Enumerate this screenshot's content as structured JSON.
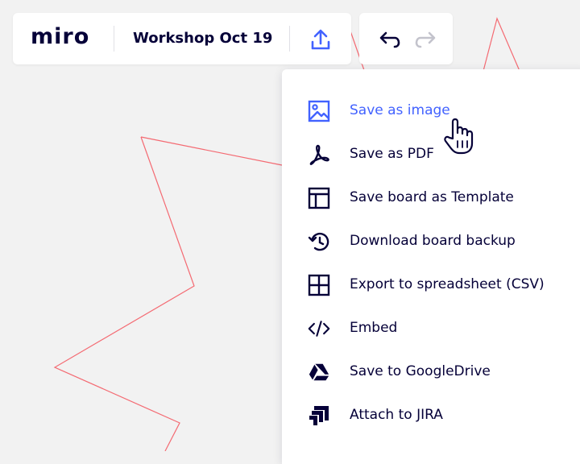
{
  "app": {
    "logo": "miro",
    "board_title": "Workshop Oct 19"
  },
  "toolbar": {
    "export_icon": "upload-icon",
    "undo_icon": "undo-icon",
    "redo_icon": "redo-icon"
  },
  "export_menu": {
    "items": [
      {
        "label": "Save as image",
        "icon": "image-icon",
        "active": true
      },
      {
        "label": "Save as PDF",
        "icon": "pdf-icon",
        "active": false
      },
      {
        "label": "Save board as Template",
        "icon": "template-icon",
        "active": false
      },
      {
        "label": "Download board backup",
        "icon": "backup-icon",
        "active": false
      },
      {
        "label": "Export to spreadsheet (CSV)",
        "icon": "spreadsheet-icon",
        "active": false
      },
      {
        "label": "Embed",
        "icon": "code-icon",
        "active": false
      },
      {
        "label": "Save to GoogleDrive",
        "icon": "google-drive-icon",
        "active": false
      },
      {
        "label": "Attach to JIRA",
        "icon": "jira-icon",
        "active": false
      }
    ]
  },
  "colors": {
    "accent": "#4262ff",
    "text": "#050038",
    "canvas_line": "#f24d57",
    "disabled": "#c3c3cc"
  }
}
